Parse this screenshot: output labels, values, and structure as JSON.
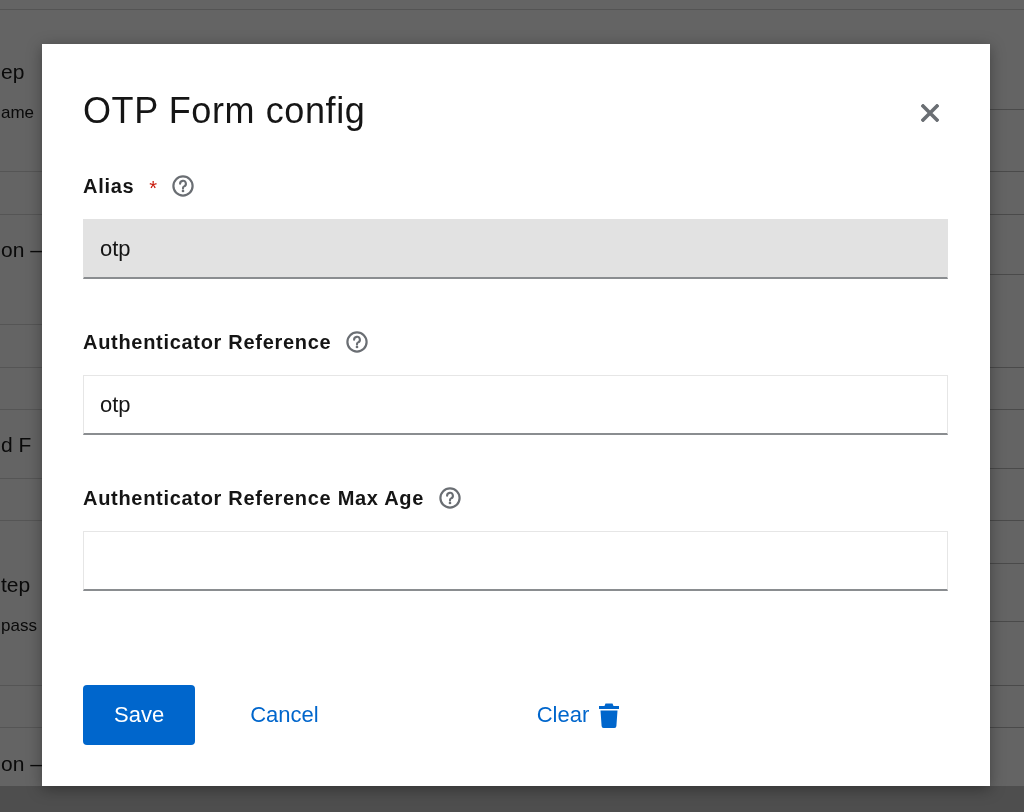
{
  "background": {
    "rows": [
      {
        "title": "ep",
        "subtitle": "ame"
      },
      {
        "title": "on –"
      },
      {
        "title": "d F"
      },
      {
        "title": "tep",
        "subtitle": "pass"
      },
      {
        "title": "on –"
      }
    ]
  },
  "dialog": {
    "title": "OTP Form config",
    "fields": [
      {
        "label": "Alias",
        "required_mark": "*",
        "value": "otp",
        "readonly": true
      },
      {
        "label": "Authenticator Reference",
        "value": "otp",
        "readonly": false
      },
      {
        "label": "Authenticator Reference Max Age",
        "readonly": false
      }
    ],
    "buttons": [
      {
        "label": "Save",
        "kind": "primary"
      },
      {
        "label": "Cancel",
        "kind": "link"
      },
      {
        "label": "Clear",
        "kind": "iconlink"
      }
    ]
  }
}
